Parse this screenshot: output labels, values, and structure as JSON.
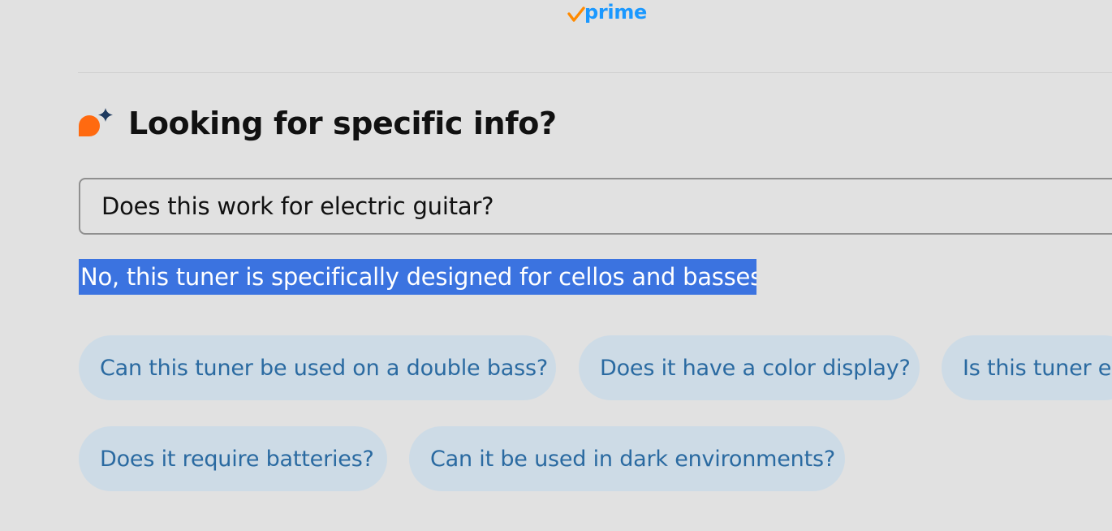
{
  "header": {
    "logo_text": "prime",
    "logo_colors": {
      "check": "#ff8a00",
      "text": "#1a98ff"
    }
  },
  "qa": {
    "title": "Looking for specific info?",
    "icon": "ai-sparkle-chat-icon",
    "icon_colors": {
      "bubble": "#ff6a10",
      "sparkle": "#1e3a5f"
    },
    "query_value": "Does this work for electric guitar?",
    "answer": "No, this tuner is specifically designed for cellos and basses.",
    "answer_highlight_color": "#3b73e0",
    "suggestions": [
      {
        "label": "Can this tuner be used on a double bass?"
      },
      {
        "label": "Does it have a color display?"
      },
      {
        "label": "Is this tuner ea"
      },
      {
        "label": "Does it require batteries?"
      },
      {
        "label": "Can it be used in dark environments?"
      }
    ]
  },
  "colors": {
    "background": "#e1e1e1",
    "chip_background": "#cddbe6",
    "chip_text": "#2a6aa1"
  }
}
